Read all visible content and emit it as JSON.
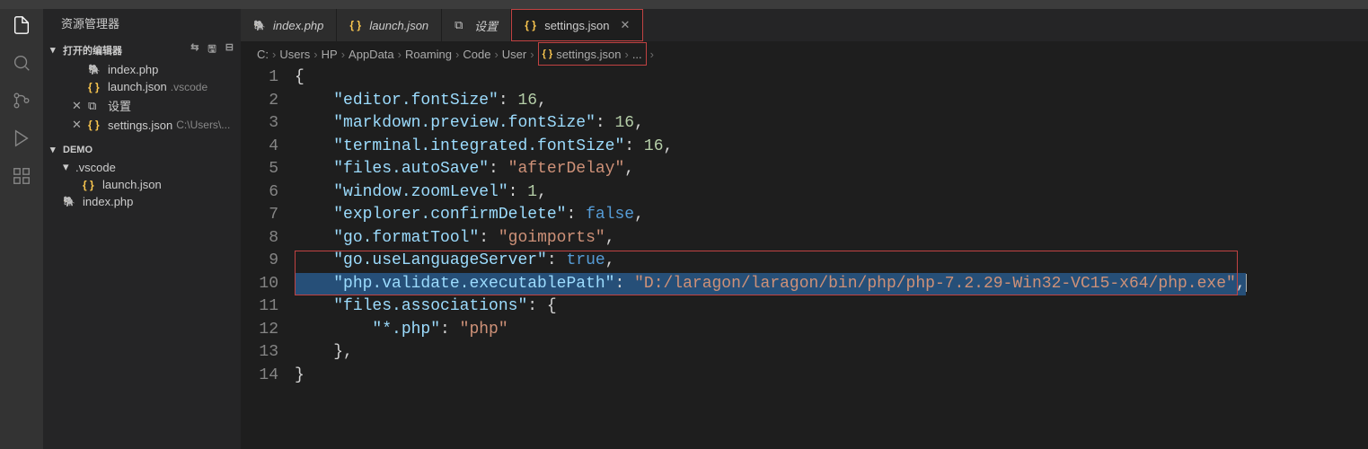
{
  "sidebar": {
    "title": "资源管理器",
    "openEditorsLabel": "打开的编辑器",
    "openEditors": [
      {
        "icon": "php",
        "name": "index.php",
        "desc": ""
      },
      {
        "icon": "json",
        "name": "launch.json",
        "desc": ".vscode"
      },
      {
        "icon": "settings",
        "name": "设置",
        "desc": "",
        "close": true
      },
      {
        "icon": "json",
        "name": "settings.json",
        "desc": "C:\\Users\\...",
        "close": true
      }
    ],
    "workspaceLabel": "DEMO",
    "tree": {
      "folder": ".vscode",
      "files": [
        "launch.json"
      ],
      "rootFiles": [
        "index.php"
      ]
    }
  },
  "tabs": [
    {
      "icon": "php",
      "label": "index.php",
      "active": false,
      "close": false
    },
    {
      "icon": "json",
      "label": "launch.json",
      "active": false,
      "close": false
    },
    {
      "icon": "settings",
      "label": "设置",
      "active": false,
      "close": false
    },
    {
      "icon": "json",
      "label": "settings.json",
      "active": true,
      "close": true
    }
  ],
  "breadcrumb": [
    "C:",
    "Users",
    "HP",
    "AppData",
    "Roaming",
    "Code",
    "User",
    "settings.json",
    "..."
  ],
  "code": {
    "lines": [
      {
        "n": 1,
        "txt": [
          [
            "{",
            "punc"
          ]
        ]
      },
      {
        "n": 2,
        "txt": [
          [
            "    ",
            ""
          ],
          [
            "\"editor.fontSize\"",
            "key"
          ],
          [
            ": ",
            "punc"
          ],
          [
            "16",
            "num"
          ],
          [
            ",",
            "punc"
          ]
        ]
      },
      {
        "n": 3,
        "txt": [
          [
            "    ",
            ""
          ],
          [
            "\"markdown.preview.fontSize\"",
            "key"
          ],
          [
            ": ",
            "punc"
          ],
          [
            "16",
            "num"
          ],
          [
            ",",
            "punc"
          ]
        ]
      },
      {
        "n": 4,
        "txt": [
          [
            "    ",
            ""
          ],
          [
            "\"terminal.integrated.fontSize\"",
            "key"
          ],
          [
            ": ",
            "punc"
          ],
          [
            "16",
            "num"
          ],
          [
            ",",
            "punc"
          ]
        ]
      },
      {
        "n": 5,
        "txt": [
          [
            "    ",
            ""
          ],
          [
            "\"files.autoSave\"",
            "key"
          ],
          [
            ": ",
            "punc"
          ],
          [
            "\"afterDelay\"",
            "str"
          ],
          [
            ",",
            "punc"
          ]
        ]
      },
      {
        "n": 6,
        "txt": [
          [
            "    ",
            ""
          ],
          [
            "\"window.zoomLevel\"",
            "key"
          ],
          [
            ": ",
            "punc"
          ],
          [
            "1",
            "num"
          ],
          [
            ",",
            "punc"
          ]
        ]
      },
      {
        "n": 7,
        "txt": [
          [
            "    ",
            ""
          ],
          [
            "\"explorer.confirmDelete\"",
            "key"
          ],
          [
            ": ",
            "punc"
          ],
          [
            "false",
            "bool"
          ],
          [
            ",",
            "punc"
          ]
        ]
      },
      {
        "n": 8,
        "txt": [
          [
            "    ",
            ""
          ],
          [
            "\"go.formatTool\"",
            "key"
          ],
          [
            ": ",
            "punc"
          ],
          [
            "\"goimports\"",
            "str"
          ],
          [
            ",",
            "punc"
          ]
        ]
      },
      {
        "n": 9,
        "txt": [
          [
            "    ",
            ""
          ],
          [
            "\"go.useLanguageServer\"",
            "key"
          ],
          [
            ": ",
            "punc"
          ],
          [
            "true",
            "bool"
          ],
          [
            ",",
            "punc"
          ]
        ]
      },
      {
        "n": 10,
        "hl": true,
        "txt": [
          [
            "    ",
            ""
          ],
          [
            "\"php.validate.executablePath\"",
            "key"
          ],
          [
            ": ",
            "punc"
          ],
          [
            "\"D:/laragon/laragon/bin/php/php-7.2.29-Win32-VC15-x64/php.exe\"",
            "str"
          ],
          [
            ",",
            "punc"
          ]
        ]
      },
      {
        "n": 11,
        "txt": [
          [
            "    ",
            ""
          ],
          [
            "\"files.associations\"",
            "key"
          ],
          [
            ": {",
            "punc"
          ]
        ]
      },
      {
        "n": 12,
        "txt": [
          [
            "        ",
            ""
          ],
          [
            "\"*.php\"",
            "key"
          ],
          [
            ": ",
            "punc"
          ],
          [
            "\"php\"",
            "str"
          ]
        ]
      },
      {
        "n": 13,
        "txt": [
          [
            "    },",
            "punc"
          ]
        ]
      },
      {
        "n": 14,
        "txt": [
          [
            "}",
            "punc"
          ]
        ]
      }
    ]
  }
}
